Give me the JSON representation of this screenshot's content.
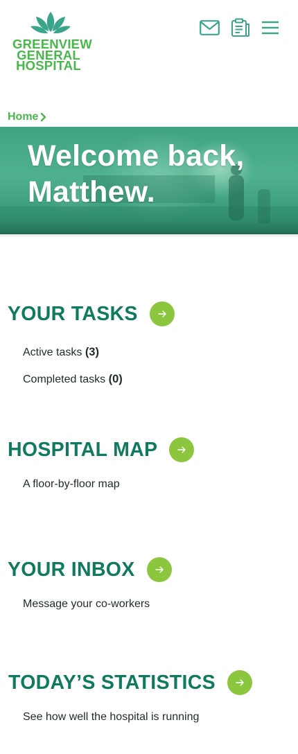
{
  "logo": {
    "lines": [
      "GREENVIEW",
      "GENERAL",
      "HOSPITAL"
    ]
  },
  "header_icons": [
    "mail-icon",
    "clipboard-icon",
    "hamburger-menu-icon"
  ],
  "breadcrumb": {
    "home": "Home"
  },
  "hero": {
    "line1": "Welcome back,",
    "line2": "Matthew."
  },
  "sections": {
    "tasks": {
      "title": "YOUR TASKS",
      "active_label": "Active tasks",
      "active_count": "(3)",
      "completed_label": "Completed tasks",
      "completed_count": "(0)"
    },
    "map": {
      "title": "HOSPITAL MAP",
      "description": "A floor-by-floor map"
    },
    "inbox": {
      "title": "YOUR INBOX",
      "description": "Message your co-workers"
    },
    "stats": {
      "title": "TODAY’S STATISTICS",
      "description": "See how well the hospital is running"
    }
  },
  "colors": {
    "brand_green": "#49b84a",
    "heading_teal": "#0f7a5f",
    "icon_teal": "#3aa58a",
    "arrow_button": "#8cc63f"
  }
}
